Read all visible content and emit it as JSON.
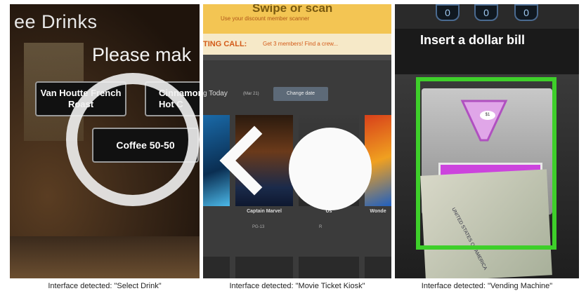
{
  "panels": [
    {
      "caption": "Interface detected: \"Select Drink\"",
      "header": "ee Drinks",
      "prompt": "Please mak",
      "buttons": [
        "Van Houtte French Roast",
        "Cinnamon Hot C",
        "Coffee 50-50"
      ]
    },
    {
      "caption": "Interface detected: \"Movie Ticket Kiosk\"",
      "banner_title": "Swipe or scan",
      "banner_sub": "Use your discount member scanner",
      "casting_label": "TING CALL:",
      "casting_text": "Get 3 members! Find a crew...",
      "showing_label": "g Today",
      "showing_date": "(Mar 21)",
      "change_button": "Change date",
      "posters": [
        {
          "title": "",
          "meta": ""
        },
        {
          "title": "Captain Marvel",
          "meta": "PG-13"
        },
        {
          "title": "Us",
          "meta": "R"
        },
        {
          "title": "Wonde",
          "meta": ""
        }
      ]
    },
    {
      "caption": "Interface detected: \"Vending Machine\"",
      "keys": [
        "0",
        "0",
        "0"
      ],
      "instruction": "Insert a dollar bill",
      "badge": "$1",
      "bill_text": "UNITED STATES OF AMERICA"
    }
  ],
  "colors": {
    "highlight_frame": "#3ecf2a",
    "ring": "#f0f0f0"
  }
}
